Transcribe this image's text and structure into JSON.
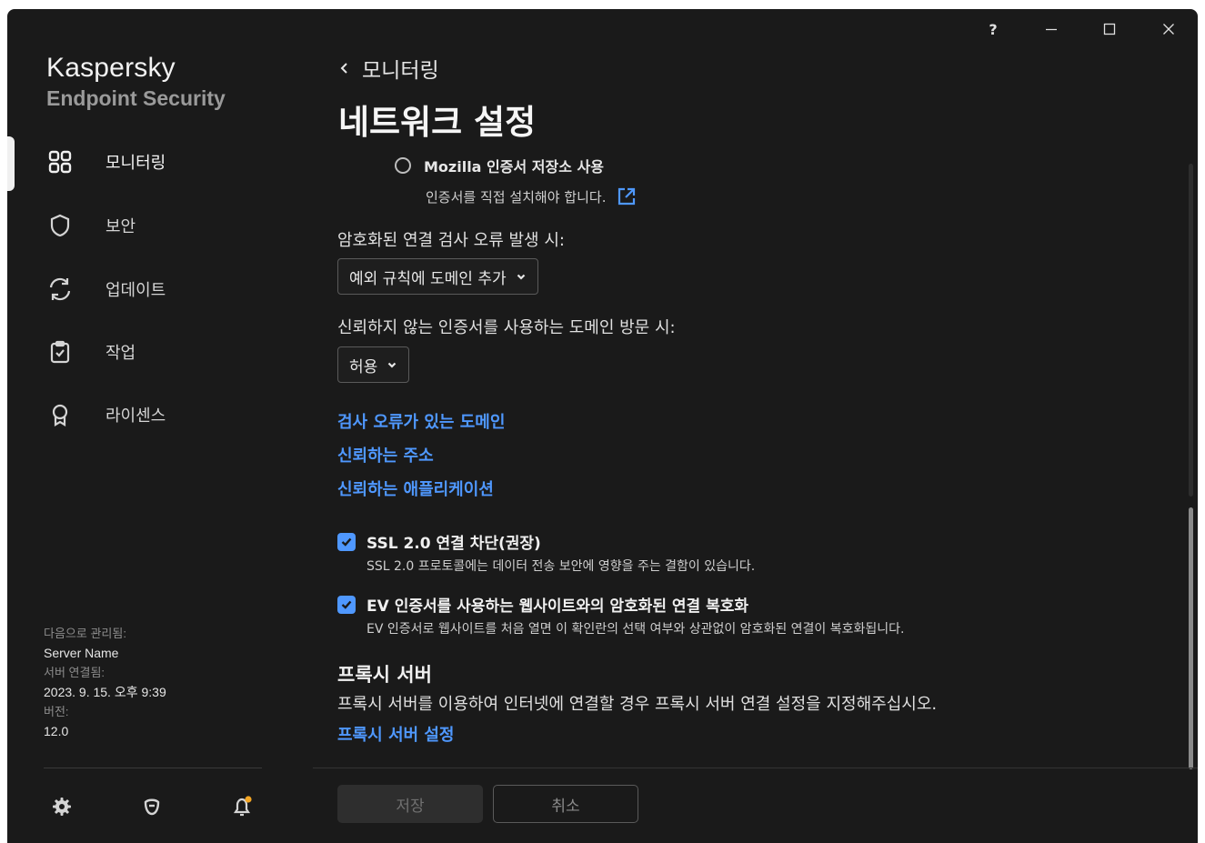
{
  "window": {
    "help_label": "?",
    "min_label": "—",
    "max_label": "☐",
    "close_label": "✕"
  },
  "sidebar": {
    "brand_line1": "Kaspersky",
    "brand_line2": "Endpoint Security",
    "items": [
      {
        "label": "모니터링",
        "icon": "dashboard-icon",
        "active": true
      },
      {
        "label": "보안",
        "icon": "shield-icon",
        "active": false
      },
      {
        "label": "업데이트",
        "icon": "update-icon",
        "active": false
      },
      {
        "label": "작업",
        "icon": "clipboard-icon",
        "active": false
      },
      {
        "label": "라이센스",
        "icon": "license-icon",
        "active": false
      }
    ],
    "managed": {
      "managed_by_label": "다음으로 관리됨:",
      "managed_by_value": "Server Name",
      "connected_label": "서버 연결됨:",
      "connected_value": "2023. 9. 15. 오후 9:39",
      "version_label": "버전:",
      "version_value": "12.0"
    },
    "tools": [
      "settings-icon",
      "support-icon",
      "notifications-icon"
    ]
  },
  "main": {
    "breadcrumb": "모니터링",
    "title": "네트워크 설정",
    "mozilla_option": "Mozilla 인증서 저장소 사용",
    "mozilla_desc": "인증서를 직접 설치해야 합니다.",
    "error_label": "암호화된 연결 검사 오류 발생 시:",
    "error_dropdown": "예외 규칙에 도메인 추가",
    "untrusted_label": "신뢰하지 않는 인증서를 사용하는 도메인 방문 시:",
    "untrusted_dropdown": "허용",
    "links": [
      "검사 오류가 있는 도메인",
      "신뢰하는 주소",
      "신뢰하는 애플리케이션"
    ],
    "ssl_label": "SSL 2.0 연결 차단(권장)",
    "ssl_desc": "SSL 2.0 프로토콜에는 데이터 전송 보안에 영향을 주는 결함이 있습니다.",
    "ev_label": "EV 인증서를 사용하는 웹사이트와의 암호화된 연결 복호화",
    "ev_desc": "EV 인증서로 웹사이트를 처음 열면 이 확인란의 선택 여부와 상관없이 암호화된 연결이 복호화됩니다.",
    "proxy_title": "프록시 서버",
    "proxy_desc": "프록시 서버를 이용하여 인터넷에 연결할 경우 프록시 서버 연결 설정을 지정해주십시오.",
    "proxy_link": "프록시 서버 설정"
  },
  "footer": {
    "save_label": "저장",
    "cancel_label": "취소"
  },
  "colors": {
    "background": "#1a1a1a",
    "accent_link": "#4f98ff",
    "notification_dot": "#f5a623"
  }
}
